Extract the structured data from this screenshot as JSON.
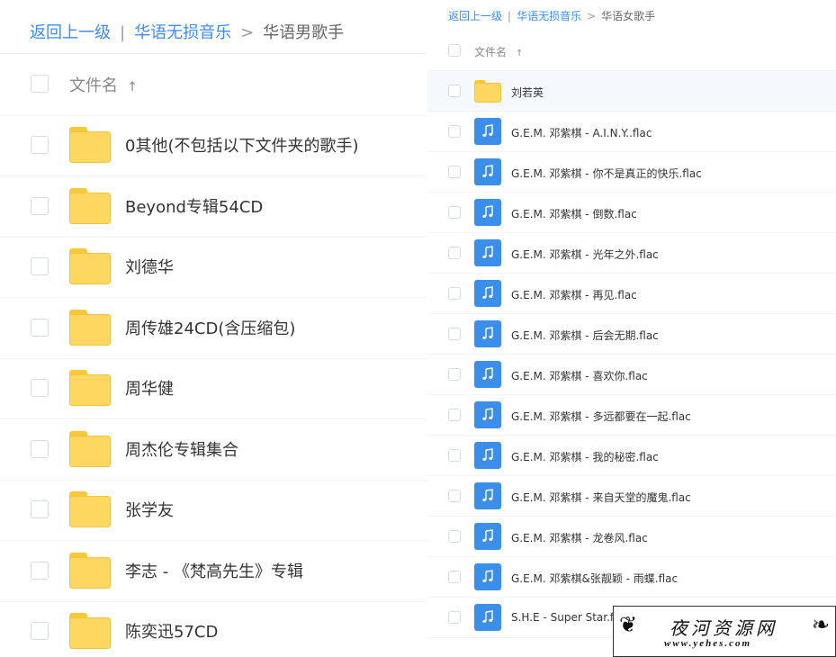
{
  "left": {
    "breadcrumb": {
      "back": "返回上一级",
      "sep": "|",
      "parent": "华语无损音乐",
      "arrow": ">",
      "current": "华语男歌手"
    },
    "header": {
      "label": "文件名",
      "sort_icon": "↑"
    },
    "rows": [
      {
        "name": "0其他(不包括以下文件夹的歌手)",
        "type": "folder"
      },
      {
        "name": "Beyond专辑54CD",
        "type": "folder"
      },
      {
        "name": "刘德华",
        "type": "folder"
      },
      {
        "name": "周传雄24CD(含压缩包)",
        "type": "folder"
      },
      {
        "name": "周华健",
        "type": "folder"
      },
      {
        "name": "周杰伦专辑集合",
        "type": "folder"
      },
      {
        "name": "张学友",
        "type": "folder"
      },
      {
        "name": "李志 - 《梵高先生》专辑",
        "type": "folder"
      },
      {
        "name": "陈奕迅57CD",
        "type": "folder"
      }
    ]
  },
  "right": {
    "breadcrumb": {
      "back": "返回上一级",
      "sep": "|",
      "parent": "华语无损音乐",
      "arrow": ">",
      "current": "华语女歌手"
    },
    "header": {
      "label": "文件名",
      "sort_icon": "↑"
    },
    "rows": [
      {
        "name": "刘若英",
        "type": "folder",
        "highlighted": true
      },
      {
        "name": "G.E.M. 邓紫棋 - A.I.N.Y..flac",
        "type": "music"
      },
      {
        "name": "G.E.M. 邓紫棋 - 你不是真正的快乐.flac",
        "type": "music"
      },
      {
        "name": "G.E.M. 邓紫棋 - 倒数.flac",
        "type": "music"
      },
      {
        "name": "G.E.M. 邓紫棋 - 光年之外.flac",
        "type": "music"
      },
      {
        "name": "G.E.M. 邓紫棋 - 再见.flac",
        "type": "music"
      },
      {
        "name": "G.E.M. 邓紫棋 - 后会无期.flac",
        "type": "music"
      },
      {
        "name": "G.E.M. 邓紫棋 - 喜欢你.flac",
        "type": "music"
      },
      {
        "name": "G.E.M. 邓紫棋 - 多远都要在一起.flac",
        "type": "music"
      },
      {
        "name": "G.E.M. 邓紫棋 - 我的秘密.flac",
        "type": "music"
      },
      {
        "name": "G.E.M. 邓紫棋 - 来自天堂的魔鬼.flac",
        "type": "music"
      },
      {
        "name": "G.E.M. 邓紫棋 - 龙卷风.flac",
        "type": "music"
      },
      {
        "name": "G.E.M. 邓紫棋&张靓颖 - 雨蝶.flac",
        "type": "music"
      },
      {
        "name": "S.H.E - Super Star.flac",
        "type": "music"
      }
    ]
  },
  "watermark": {
    "title": "夜河资源网",
    "url": "www.yehes.com"
  },
  "colors": {
    "link": "#3b8cff",
    "folder": "#fdd75f",
    "music_icon": "#3b8ee9",
    "highlight_row": "#f5f8fd"
  }
}
